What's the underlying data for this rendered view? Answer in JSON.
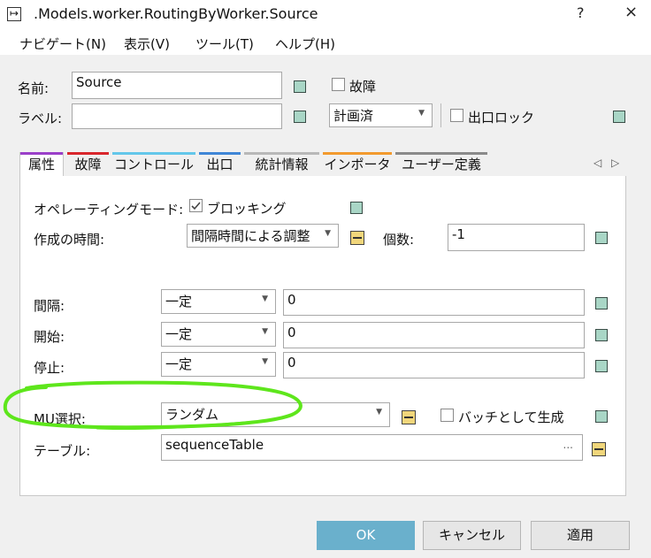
{
  "window": {
    "icon": "route-arrow-icon",
    "title": ".Models.worker.RoutingByWorker.Source",
    "help": "?",
    "close": "×"
  },
  "menu": [
    "ナビゲート(N)",
    "表示(V)",
    "ツール(T)",
    "ヘルプ(H)"
  ],
  "header": {
    "name_label": "名前:",
    "name_value": "Source",
    "failure_label": "故障",
    "label_label": "ラベル:",
    "label_value": "",
    "status_value": "計画済",
    "exit_lock_label": "出口ロック"
  },
  "tabs": [
    {
      "label": "属性",
      "color": "#9a3fc9",
      "active": true
    },
    {
      "label": "故障",
      "color": "#d9262c"
    },
    {
      "label": "コントロール",
      "color": "#63c7ea"
    },
    {
      "label": "出口",
      "color": "#3f86d6"
    },
    {
      "label": "統計情報",
      "color": "#b8b8b8"
    },
    {
      "label": "インポータ",
      "color": "#f29a2e"
    },
    {
      "label": "ユーザー定義",
      "color": "#8a8a8a"
    }
  ],
  "tab_nav": {
    "prev": "◁",
    "next": "▷"
  },
  "attributes": {
    "operating_mode_label": "オペレーティングモード:",
    "blocking_label": "ブロッキング",
    "blocking_checked": true,
    "creation_time_label": "作成の時間:",
    "creation_time_value": "間隔時間による調整",
    "count_label": "個数:",
    "count_value": "-1",
    "interval_label": "間隔:",
    "interval_dist": "一定",
    "interval_value": "0",
    "start_label": "開始:",
    "start_dist": "一定",
    "start_value": "0",
    "stop_label": "停止:",
    "stop_dist": "一定",
    "stop_value": "0",
    "mu_selection_label": "MU選択:",
    "mu_selection_value": "ランダム",
    "batch_label": "バッチとして生成",
    "table_label": "テーブル:",
    "table_value": "sequenceTable",
    "table_browse": "..."
  },
  "buttons": {
    "ok": "OK",
    "cancel": "キャンセル",
    "apply": "適用"
  },
  "colors": {
    "accent_ok": "#6ab0cc",
    "green_square": "#a9d6c6",
    "yellow_square": "#f1d67b",
    "annotation": "#5ee61c"
  }
}
